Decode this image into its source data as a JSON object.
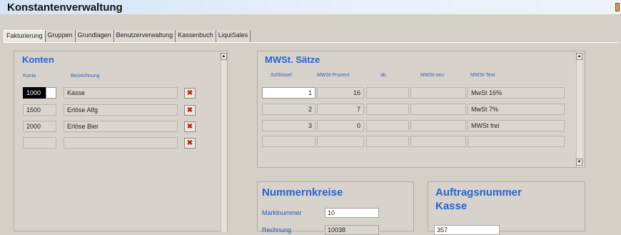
{
  "window": {
    "title": "Konstantenverwaltung"
  },
  "tabs": [
    {
      "label": "Fakturierung"
    },
    {
      "label": "Gruppen"
    },
    {
      "label": "Grundlagen"
    },
    {
      "label": "Benutzerverwaltung"
    },
    {
      "label": "Kassenbuch"
    },
    {
      "label": "LiquiSales"
    }
  ],
  "konten": {
    "title": "Konten",
    "col_konto": "Konto",
    "col_bezeichnung": "Bezeichnung",
    "rows": [
      {
        "konto": "1000",
        "bezeichnung": "Kasse"
      },
      {
        "konto": "1500",
        "bezeichnung": "Erlöse Alfg"
      },
      {
        "konto": "2000",
        "bezeichnung": "Erlöse Bier"
      },
      {
        "konto": "",
        "bezeichnung": ""
      }
    ]
  },
  "mwst": {
    "title": "MWSt. Sätze",
    "col_schluessel": "Schlüssel",
    "col_prozent": "MWSt-Prozent",
    "col_ab": "ab",
    "col_neu": "MWSt-neu",
    "col_text": "MWSt-Text",
    "rows": [
      {
        "schluessel": "1",
        "prozent": "16",
        "ab": "",
        "neu": "",
        "text": "MwSt 16%"
      },
      {
        "schluessel": "2",
        "prozent": "7",
        "ab": "",
        "neu": "",
        "text": "MwSt 7%"
      },
      {
        "schluessel": "3",
        "prozent": "0",
        "ab": "",
        "neu": "",
        "text": "MWSt frei"
      },
      {
        "schluessel": "",
        "prozent": "",
        "ab": "",
        "neu": "",
        "text": ""
      }
    ]
  },
  "nummernkreise": {
    "title": "Nummernkreise",
    "marktnummer_label": "Marktnummer",
    "marktnummer_value": "10",
    "rechnung_label": "Rechnung",
    "rechnung_value": "10038"
  },
  "auftrag": {
    "title_line1": "Auftragsnummer",
    "title_line2": "Kasse",
    "value": "357"
  }
}
